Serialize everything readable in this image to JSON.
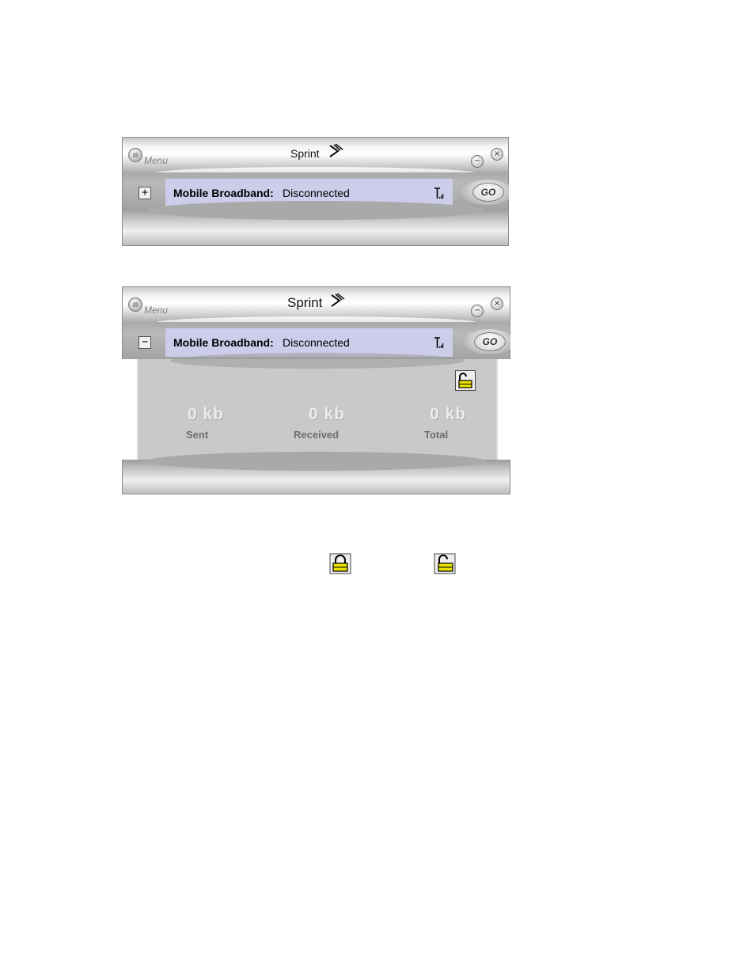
{
  "windows": [
    {
      "menu_label": "Menu",
      "brand": "Sprint",
      "toggle_symbol": "+",
      "status_label": "Mobile Broadband:",
      "status_value": "Disconnected",
      "go_label": "GO",
      "icons": [
        "menu-icon",
        "sprint-logo-icon",
        "minimize-icon",
        "close-icon",
        "signal-icon"
      ]
    },
    {
      "menu_label": "Menu",
      "brand": "Sprint",
      "toggle_symbol": "−",
      "status_label": "Mobile Broadband:",
      "status_value": "Disconnected",
      "go_label": "GO",
      "stats": [
        {
          "value": "0 kb",
          "label": "Sent"
        },
        {
          "value": "0 kb",
          "label": "Received"
        },
        {
          "value": "0 kb",
          "label": "Total"
        }
      ],
      "icons": [
        "menu-icon",
        "sprint-logo-icon",
        "minimize-icon",
        "close-icon",
        "signal-icon",
        "unlocked-padlock-icon"
      ]
    }
  ],
  "legend_icons": [
    "locked-padlock-icon",
    "unlocked-padlock-icon"
  ],
  "colors": {
    "status_bar": "#cccceb",
    "panel": "#c9c9c9",
    "padlock": "#e8e000"
  }
}
